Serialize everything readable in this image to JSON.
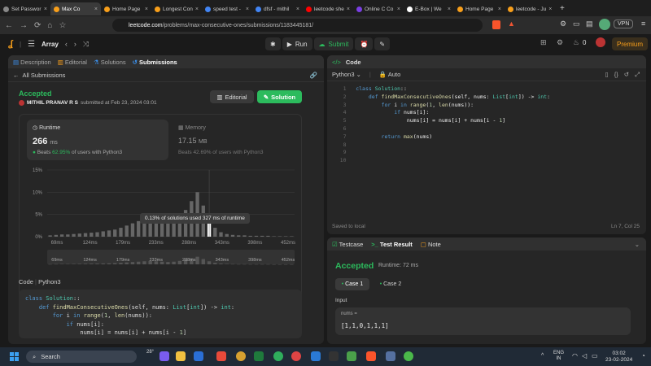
{
  "tabs": [
    {
      "label": "Set Passwor",
      "color": "#888"
    },
    {
      "label": "Max Co",
      "color": "#f89f1b",
      "active": true
    },
    {
      "label": "Home Page",
      "color": "#f89f1b"
    },
    {
      "label": "Longest Con",
      "color": "#f89f1b"
    },
    {
      "label": "speed test -",
      "color": "#4285f4"
    },
    {
      "label": "dfsf - mithil",
      "color": "#4285f4"
    },
    {
      "label": "leetcode she",
      "color": "#ff0000"
    },
    {
      "label": "Online C Co",
      "color": "#7b3fe4"
    },
    {
      "label": "E-Box | We",
      "color": "#fff"
    },
    {
      "label": "Home Page",
      "color": "#f89f1b"
    },
    {
      "label": "leetcode - Ju",
      "color": "#f89f1b"
    }
  ],
  "address": {
    "host": "leetcode.com",
    "path": "/problems/max-consecutive-ones/submissions/1183445181/",
    "vpn": "VPN"
  },
  "lcnav": {
    "list": "Array",
    "run": "Run",
    "submit": "Submit",
    "coins": "0",
    "premium": "Premium"
  },
  "left_tabs": [
    "Description",
    "Editorial",
    "Solutions",
    "Submissions"
  ],
  "sub": {
    "all": "All Submissions",
    "status": "Accepted",
    "user": "MITHIL PRANAV R S",
    "submitted": "submitted at Feb 23, 2024 03:01",
    "editorial_btn": "Editorial",
    "solution_btn": "Solution",
    "runtime_label": "Runtime",
    "runtime_value": "266",
    "runtime_unit": "ms",
    "beats_prefix": "Beats",
    "runtime_beats": "62.95%",
    "beats_suffix": "of users with Python3",
    "memory_label": "Memory",
    "memory_value": "17.15",
    "memory_unit": "MB",
    "memory_beats": "42.69%",
    "tooltip": "0.13% of solutions used 327 ms of runtime",
    "code_label": "Code",
    "lang": "Python3"
  },
  "chart_data": {
    "type": "bar",
    "ylabels": [
      "15%",
      "10%",
      "5%",
      "0%"
    ],
    "ylim": [
      0,
      15
    ],
    "xlabels": [
      "69ms",
      "124ms",
      "179ms",
      "233ms",
      "288ms",
      "343ms",
      "398ms",
      "452ms"
    ],
    "values": [
      0.3,
      0.4,
      0.5,
      0.5,
      0.6,
      0.7,
      0.8,
      0.9,
      1.0,
      1.2,
      1.4,
      1.6,
      2.0,
      2.5,
      3.0,
      3.5,
      4.0,
      4.5,
      4.0,
      3.5,
      3.0,
      3.5,
      4.5,
      6.0,
      8.0,
      10.0,
      7.0,
      4.0,
      2.0,
      1.0,
      0.6,
      0.4,
      0.3,
      0.3,
      0.2,
      0.2,
      0.2,
      0.2,
      0.1,
      0.1,
      0.1,
      0.1
    ],
    "highlight_index": 27,
    "highlight_value": 0.13
  },
  "editor": {
    "lang": "Python3",
    "mode": "Auto",
    "saved": "Saved to local",
    "cursor": "Ln 7, Col 25",
    "lines": [
      [
        [
          "kw",
          "class "
        ],
        [
          "cls",
          "Solution"
        ],
        [
          "",
          "::"
        ]
      ],
      [
        [
          "",
          "    "
        ],
        [
          "kw",
          "def "
        ],
        [
          "fn",
          "findMaxConsecutiveOnes"
        ],
        [
          "",
          "(self, nums: "
        ],
        [
          "cls",
          "List"
        ],
        [
          "",
          "["
        ],
        [
          "bi",
          "int"
        ],
        [
          "",
          "]) -> "
        ],
        [
          "bi",
          "int"
        ],
        [
          "",
          ":"
        ]
      ],
      [
        [
          "",
          "        "
        ],
        [
          "kw",
          "for "
        ],
        [
          "",
          "i "
        ],
        [
          "kw",
          "in "
        ],
        [
          "fn",
          "range"
        ],
        [
          "",
          "("
        ],
        [
          "num",
          "1"
        ],
        [
          "",
          ", "
        ],
        [
          "fn",
          "len"
        ],
        [
          "",
          "(nums)):"
        ]
      ],
      [
        [
          "",
          "            "
        ],
        [
          "kw",
          "if "
        ],
        [
          "",
          "nums[i]:"
        ]
      ],
      [
        [
          "",
          "                nums[i] = nums[i] + nums[i - "
        ],
        [
          "num",
          "1"
        ],
        [
          "",
          "]"
        ]
      ],
      [
        [
          "",
          ""
        ]
      ],
      [
        [
          "",
          "        "
        ],
        [
          "kw",
          "return "
        ],
        [
          "fn",
          "max"
        ],
        [
          "",
          "(nums)"
        ]
      ],
      [
        [
          "",
          ""
        ]
      ],
      [
        [
          "",
          ""
        ]
      ],
      [
        [
          "",
          ""
        ]
      ]
    ]
  },
  "bottom": {
    "tabs": [
      "Testcase",
      "Test Result",
      "Note"
    ],
    "status": "Accepted",
    "runtime": "Runtime: 72 ms",
    "cases": [
      "Case 1",
      "Case 2"
    ],
    "input_label": "Input",
    "var": "nums =",
    "val": "[1,1,0,1,1,1]"
  },
  "taskbar": {
    "search": "Search",
    "temp": "28°",
    "lang1": "ENG",
    "lang2": "IN",
    "time": "03:02",
    "date": "23-02-2024"
  }
}
